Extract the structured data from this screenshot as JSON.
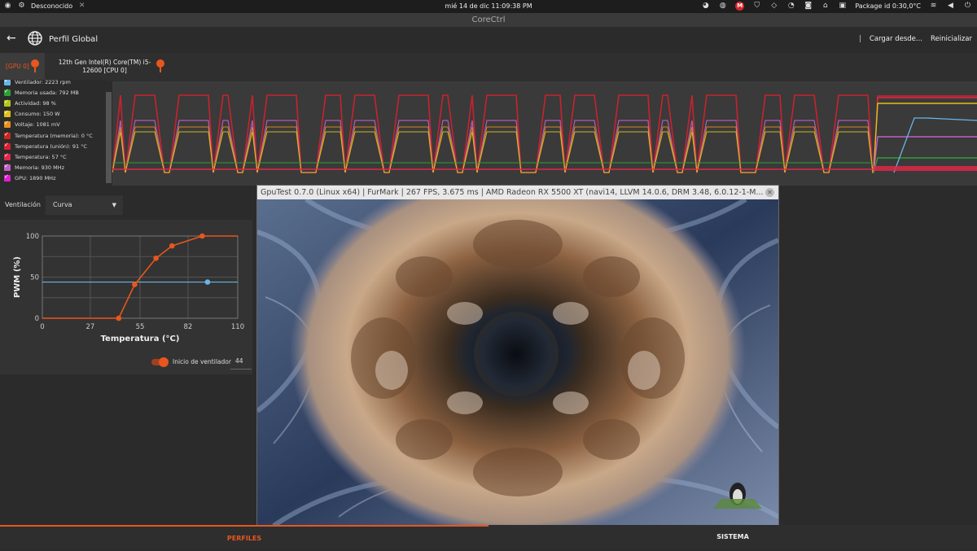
{
  "system_bar": {
    "workspace": "Desconocido",
    "datetime": "mié 14 de dic  11:09:38 PM",
    "sensor": "Package id 0:30,0°C"
  },
  "window": {
    "title": "CoreCtrl"
  },
  "header": {
    "title": "Perfil Global",
    "load_label": "Cargar desde...",
    "reset_label": "Reinicializar"
  },
  "devices": [
    {
      "label": "[GPU 0]"
    },
    {
      "label": "12th Gen Intel(R) Core(TM) i5-12600 [CPU 0]"
    }
  ],
  "sensors": [
    {
      "label": "Ventilador: 2223 rpm",
      "color": "#6ab4e6"
    },
    {
      "label": "Memoria usada: 792 MB",
      "color": "#2e9e36"
    },
    {
      "label": "Actividad: 98 %",
      "color": "#b4c61a"
    },
    {
      "label": "Consumo: 150 W",
      "color": "#e0c01a"
    },
    {
      "label": "Voltaje: 1081 mV",
      "color": "#e8901e"
    },
    {
      "label": "Temperatura (memoria): 0 °C",
      "color": "#c8281e"
    },
    {
      "label": "Temperatura (unión): 91 °C",
      "color": "#d8202e"
    },
    {
      "label": "Temperatura: 57 °C",
      "color": "#e02848"
    },
    {
      "label": "Memoria: 930 MHz",
      "color": "#c060c0"
    },
    {
      "label": "GPU: 1890 MHz",
      "color": "#e020d0"
    }
  ],
  "fan": {
    "label": "Ventilación",
    "mode": "Curva",
    "start_label": "Inicio de ventilador",
    "start_value": "44"
  },
  "chart_data": {
    "type": "line",
    "xlabel": "Temperatura (°C)",
    "ylabel": "PWM (%)",
    "xlim": [
      0,
      110
    ],
    "ylim": [
      0,
      100
    ],
    "x_ticks": [
      "0",
      "27",
      "55",
      "82",
      "110"
    ],
    "y_ticks": [
      "0",
      "50",
      "100"
    ],
    "series": [
      {
        "points": [
          [
            0,
            0
          ],
          [
            43,
            0
          ],
          [
            52,
            41
          ],
          [
            64,
            73
          ],
          [
            73,
            88
          ],
          [
            90,
            100
          ],
          [
            110,
            100
          ]
        ],
        "color": "#e8561e"
      }
    ],
    "current_point": {
      "x": 93,
      "y": 44,
      "color": "#6ab4e6"
    }
  },
  "gputest": {
    "title": "GpuTest 0.7.0 (Linux x64) | FurMark | 267 FPS, 3.675 ms | AMD Radeon RX 5500 XT (navi14, LLVM 14.0.6, DRM 3.48, 6.0.12-1-M..."
  },
  "bottom_tabs": {
    "profiles": "PERFILES",
    "system": "SISTEMA"
  }
}
